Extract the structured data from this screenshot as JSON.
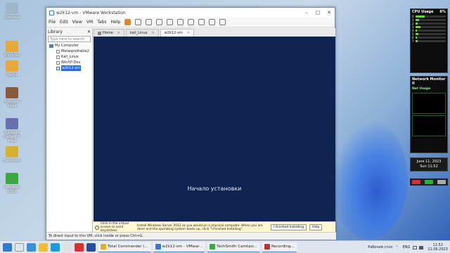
{
  "desktop_icons": [
    {
      "label": "Корзина",
      "color": "#9fb7cc"
    },
    {
      "label": "Windows",
      "color": "#e8a93a"
    },
    {
      "label": "Hacks",
      "color": "#e8a93a"
    },
    {
      "label": "Аукцион тема",
      "color": "#8a5a3a"
    },
    {
      "label": "Gadgets Gallery 7 Mod",
      "color": "#6a6fb0"
    },
    {
      "label": "Bandicam",
      "color": "#d8b030"
    },
    {
      "label": "Camtasia 2019",
      "color": "#3ba840"
    }
  ],
  "window": {
    "title": "w2k12-vm - VMware Workstation",
    "menu": [
      "File",
      "Edit",
      "View",
      "VM",
      "Tabs",
      "Help"
    ]
  },
  "library": {
    "header": "Library",
    "search_placeholder": "Type here to search",
    "root": "My Computer",
    "items": [
      "Metasploitable2",
      "Kali_Linux",
      "WinXP-Dev",
      "w2k12-vm"
    ]
  },
  "tabs": [
    {
      "label": "Home"
    },
    {
      "label": "kali_Linux"
    },
    {
      "label": "w2k12-vm"
    }
  ],
  "vm": {
    "setup_text": "Начало установки"
  },
  "hint": {
    "text1": "Click in the virtual screen to send keystrokes",
    "text2": "Install Windows Server 2012 as you would on a physical computer. When you are done and the operating system boots up, click \"I Finished Installing\".",
    "finish_button": "I Finished Installing",
    "help_button": "Help"
  },
  "statusbar": "To direct input to this VM, click inside or press Ctrl+G.",
  "gadgets": {
    "cpu_title": "CPU Usage",
    "cpu_value": "6%",
    "net_title": "Network Monitor II",
    "net_usage": "Net Usage"
  },
  "clock": {
    "date": "June 11, 2023",
    "day_time": "Sun 11:52"
  },
  "taskbar": {
    "apps": [
      {
        "label": "Total Commander (...",
        "color": "#e0b020"
      },
      {
        "label": "w2k12-vm - VMwar...",
        "color": "#2e7bcf"
      },
      {
        "label": "TechSmith Camtasi...",
        "color": "#3ba840"
      },
      {
        "label": "Recording...",
        "color": "#c03030"
      }
    ],
    "tray_label": "Рабочий стол",
    "lang": "ENG",
    "time": "11:52",
    "date": "11.06.2023"
  }
}
